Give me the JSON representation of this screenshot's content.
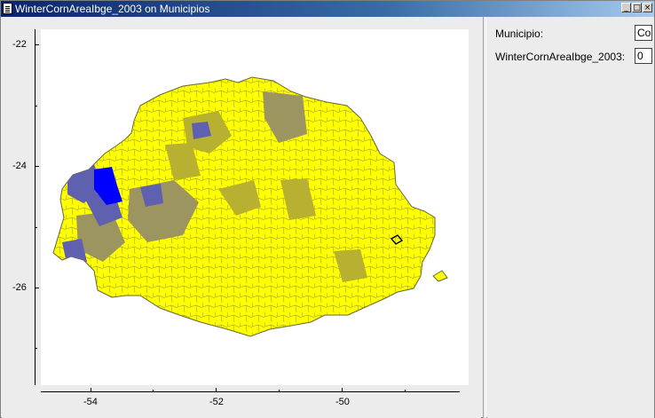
{
  "window": {
    "title": "WinterCornAreaIbge_2003 on Municipios",
    "controls": [
      "minimize-icon",
      "maximize-icon",
      "close-icon"
    ]
  },
  "plot": {
    "x_ticks": [
      "-54",
      "-52",
      "-50"
    ],
    "y_ticks": [
      "-22",
      "-24",
      "-26"
    ],
    "colors": {
      "base": "#ffff00",
      "dark_gold": "#b8b030",
      "olive_gray": "#9c9560",
      "slate_blue": "#6060b0",
      "blue": "#0000ff",
      "border": "#666633"
    }
  },
  "info": {
    "fields": [
      {
        "label": "Municipio:",
        "value": "Co"
      },
      {
        "label": "WinterCornAreaIbge_2003:",
        "value": "0"
      }
    ]
  }
}
